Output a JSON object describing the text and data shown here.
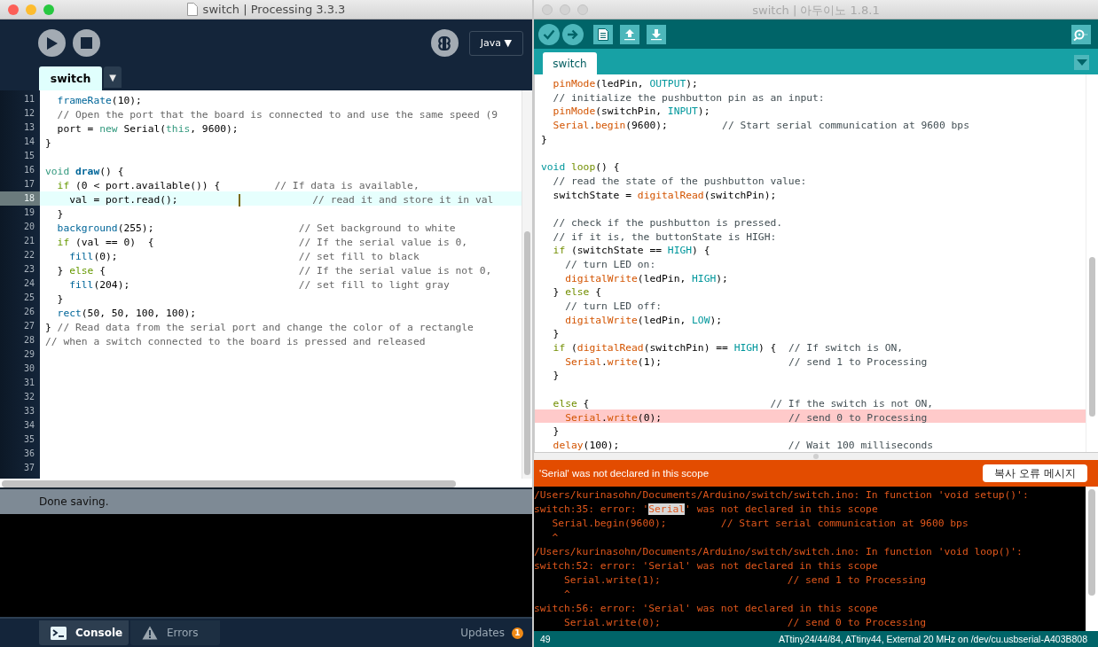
{
  "processing": {
    "title": "switch | Processing 3.3.3",
    "mode": "Java ▼",
    "tab": "switch",
    "tab_menu": "▼",
    "lines": [
      {
        "number": "11",
        "highlighted": false,
        "tokens": [
          {
            "text": "  frameRate",
            "kind": "fn"
          },
          {
            "text": "(10);",
            "kind": "t"
          }
        ]
      },
      {
        "number": "12",
        "highlighted": false,
        "tokens": [
          {
            "text": "  // Open the port that the board is connected to and use the same speed (9",
            "kind": "c"
          }
        ]
      },
      {
        "number": "13",
        "highlighted": false,
        "tokens": [
          {
            "text": "  port = ",
            "kind": "t"
          },
          {
            "text": "new",
            "kind": "kw"
          },
          {
            "text": " Serial(",
            "kind": "t"
          },
          {
            "text": "this",
            "kind": "kw"
          },
          {
            "text": ", 9600);",
            "kind": "t"
          }
        ]
      },
      {
        "number": "14",
        "highlighted": false,
        "tokens": [
          {
            "text": "}",
            "kind": "t"
          }
        ]
      },
      {
        "number": "15",
        "highlighted": false
      },
      {
        "number": "16",
        "highlighted": false,
        "tokens": [
          {
            "text": "void",
            "kind": "kw"
          },
          {
            "text": " draw",
            "kind": "fnb"
          },
          {
            "text": "() {",
            "kind": "t"
          }
        ]
      },
      {
        "number": "17",
        "highlighted": false,
        "tokens": [
          {
            "text": "  if",
            "kind": "ctl"
          },
          {
            "text": " (0 < port.available()) {         ",
            "kind": "t"
          },
          {
            "text": "// If data is available,",
            "kind": "c"
          }
        ]
      },
      {
        "number": "18",
        "highlighted": true,
        "cursor": true,
        "tokens": [
          {
            "text": "    val = port.read();          ",
            "kind": "t"
          },
          {
            "text": "            // read it and store it in val",
            "kind": "c"
          }
        ]
      },
      {
        "number": "19",
        "highlighted": false,
        "tokens": [
          {
            "text": "  }",
            "kind": "t"
          }
        ]
      },
      {
        "number": "20",
        "highlighted": false,
        "tokens": [
          {
            "text": "  background",
            "kind": "fn"
          },
          {
            "text": "(255);                        ",
            "kind": "t"
          },
          {
            "text": "// Set background to white",
            "kind": "c"
          }
        ]
      },
      {
        "number": "21",
        "highlighted": false,
        "tokens": [
          {
            "text": "  if",
            "kind": "ctl"
          },
          {
            "text": " (val == 0)  {                        ",
            "kind": "t"
          },
          {
            "text": "// If the serial value is 0,",
            "kind": "c"
          }
        ]
      },
      {
        "number": "22",
        "highlighted": false,
        "tokens": [
          {
            "text": "    fill",
            "kind": "fn"
          },
          {
            "text": "(0);                              ",
            "kind": "t"
          },
          {
            "text": "// set fill to black",
            "kind": "c"
          }
        ]
      },
      {
        "number": "23",
        "highlighted": false,
        "tokens": [
          {
            "text": "  } ",
            "kind": "t"
          },
          {
            "text": "else",
            "kind": "ctl"
          },
          {
            "text": " {                                ",
            "kind": "t"
          },
          {
            "text": "// If the serial value is not 0,",
            "kind": "c"
          }
        ]
      },
      {
        "number": "24",
        "highlighted": false,
        "tokens": [
          {
            "text": "    fill",
            "kind": "fn"
          },
          {
            "text": "(204);                            ",
            "kind": "t"
          },
          {
            "text": "// set fill to light gray",
            "kind": "c"
          }
        ]
      },
      {
        "number": "25",
        "highlighted": false,
        "tokens": [
          {
            "text": "  }",
            "kind": "t"
          }
        ]
      },
      {
        "number": "26",
        "highlighted": false,
        "tokens": [
          {
            "text": "  rect",
            "kind": "fn"
          },
          {
            "text": "(50, 50, 100, 100);",
            "kind": "t"
          }
        ]
      },
      {
        "number": "27",
        "highlighted": false,
        "tokens": [
          {
            "text": "} ",
            "kind": "t"
          },
          {
            "text": "// Read data from the serial port and change the color of a rectangle",
            "kind": "c"
          }
        ]
      },
      {
        "number": "28",
        "highlighted": false,
        "tokens": [
          {
            "text": "// when a switch connected to the board is pressed and released",
            "kind": "c"
          }
        ]
      },
      {
        "number": "29",
        "highlighted": false
      },
      {
        "number": "30",
        "highlighted": false
      },
      {
        "number": "31",
        "highlighted": false
      },
      {
        "number": "32",
        "highlighted": false
      },
      {
        "number": "33",
        "highlighted": false
      },
      {
        "number": "34",
        "highlighted": false
      },
      {
        "number": "35",
        "highlighted": false
      },
      {
        "number": "36",
        "highlighted": false
      },
      {
        "number": "37",
        "highlighted": false
      }
    ],
    "status": "Done saving.",
    "console_tabs": [
      {
        "label": "Console",
        "selected": true,
        "kind": "console"
      },
      {
        "label": "Errors",
        "selected": false,
        "kind": "errors"
      }
    ],
    "updates": {
      "label": "Updates",
      "count": "1"
    }
  },
  "arduino": {
    "title": "switch | 아두이노 1.8.1",
    "tab": "switch",
    "lines": [
      {
        "highlighted": false,
        "tokens": [
          {
            "text": "  pinMode",
            "kind": "fn"
          },
          {
            "text": "(ledPin, ",
            "kind": "t"
          },
          {
            "text": "OUTPUT",
            "kind": "const"
          },
          {
            "text": ");",
            "kind": "t"
          }
        ]
      },
      {
        "highlighted": false,
        "tokens": [
          {
            "text": "  // initialize the pushbutton pin as an input:",
            "kind": "c"
          }
        ]
      },
      {
        "highlighted": false,
        "tokens": [
          {
            "text": "  pinMode",
            "kind": "fn"
          },
          {
            "text": "(switchPin, ",
            "kind": "t"
          },
          {
            "text": "INPUT",
            "kind": "const"
          },
          {
            "text": ");",
            "kind": "t"
          }
        ]
      },
      {
        "highlighted": false,
        "tokens": [
          {
            "text": "  Serial",
            "kind": "fn"
          },
          {
            "text": ".",
            "kind": "t"
          },
          {
            "text": "begin",
            "kind": "fn"
          },
          {
            "text": "(9600);         ",
            "kind": "t"
          },
          {
            "text": "// Start serial communication at 9600 bps",
            "kind": "c"
          }
        ]
      },
      {
        "highlighted": false,
        "tokens": [
          {
            "text": "}",
            "kind": "t"
          }
        ]
      },
      {
        "highlighted": false
      },
      {
        "highlighted": false,
        "tokens": [
          {
            "text": "void",
            "kind": "type"
          },
          {
            "text": " loop",
            "kind": "kw"
          },
          {
            "text": "() {",
            "kind": "t"
          }
        ]
      },
      {
        "highlighted": false,
        "tokens": [
          {
            "text": "  // read the state of the pushbutton value:",
            "kind": "c"
          }
        ]
      },
      {
        "highlighted": false,
        "tokens": [
          {
            "text": "  switchState = ",
            "kind": "t"
          },
          {
            "text": "digitalRead",
            "kind": "fn"
          },
          {
            "text": "(switchPin);",
            "kind": "t"
          }
        ]
      },
      {
        "highlighted": false
      },
      {
        "highlighted": false,
        "tokens": [
          {
            "text": "  // check if the pushbutton is pressed.",
            "kind": "c"
          }
        ]
      },
      {
        "highlighted": false,
        "tokens": [
          {
            "text": "  // if it is, the buttonState is HIGH:",
            "kind": "c"
          }
        ]
      },
      {
        "highlighted": false,
        "tokens": [
          {
            "text": "  if",
            "kind": "kw"
          },
          {
            "text": " (switchState == ",
            "kind": "t"
          },
          {
            "text": "HIGH",
            "kind": "const"
          },
          {
            "text": ") {",
            "kind": "t"
          }
        ]
      },
      {
        "highlighted": false,
        "tokens": [
          {
            "text": "    // turn LED on:",
            "kind": "c"
          }
        ]
      },
      {
        "highlighted": false,
        "tokens": [
          {
            "text": "    digitalWrite",
            "kind": "fn"
          },
          {
            "text": "(ledPin, ",
            "kind": "t"
          },
          {
            "text": "HIGH",
            "kind": "const"
          },
          {
            "text": ");",
            "kind": "t"
          }
        ]
      },
      {
        "highlighted": false,
        "tokens": [
          {
            "text": "  } ",
            "kind": "t"
          },
          {
            "text": "else",
            "kind": "kw"
          },
          {
            "text": " {",
            "kind": "t"
          }
        ]
      },
      {
        "highlighted": false,
        "tokens": [
          {
            "text": "    // turn LED off:",
            "kind": "c"
          }
        ]
      },
      {
        "highlighted": false,
        "tokens": [
          {
            "text": "    digitalWrite",
            "kind": "fn"
          },
          {
            "text": "(ledPin, ",
            "kind": "t"
          },
          {
            "text": "LOW",
            "kind": "const"
          },
          {
            "text": ");",
            "kind": "t"
          }
        ]
      },
      {
        "highlighted": false,
        "tokens": [
          {
            "text": "  }",
            "kind": "t"
          }
        ]
      },
      {
        "highlighted": false,
        "tokens": [
          {
            "text": "  if",
            "kind": "kw"
          },
          {
            "text": " (",
            "kind": "t"
          },
          {
            "text": "digitalRead",
            "kind": "fn"
          },
          {
            "text": "(switchPin) == ",
            "kind": "t"
          },
          {
            "text": "HIGH",
            "kind": "const"
          },
          {
            "text": ") {  ",
            "kind": "t"
          },
          {
            "text": "// If switch is ON,",
            "kind": "c"
          }
        ]
      },
      {
        "highlighted": false,
        "tokens": [
          {
            "text": "    Serial",
            "kind": "fn"
          },
          {
            "text": ".",
            "kind": "t"
          },
          {
            "text": "write",
            "kind": "fn"
          },
          {
            "text": "(1);                     ",
            "kind": "t"
          },
          {
            "text": "// send 1 to Processing",
            "kind": "c"
          }
        ]
      },
      {
        "highlighted": false,
        "tokens": [
          {
            "text": "  }",
            "kind": "t"
          }
        ]
      },
      {
        "highlighted": false
      },
      {
        "highlighted": false,
        "tokens": [
          {
            "text": "  else",
            "kind": "kw"
          },
          {
            "text": " {                              ",
            "kind": "t"
          },
          {
            "text": "// If the switch is not ON,",
            "kind": "c"
          }
        ]
      },
      {
        "highlighted": true,
        "tokens": [
          {
            "text": "    Serial",
            "kind": "fn"
          },
          {
            "text": ".",
            "kind": "t"
          },
          {
            "text": "write",
            "kind": "fn"
          },
          {
            "text": "(0);                     ",
            "kind": "t"
          },
          {
            "text": "// send 0 to Processing",
            "kind": "c"
          }
        ]
      },
      {
        "highlighted": false,
        "tokens": [
          {
            "text": "  }",
            "kind": "t"
          }
        ]
      },
      {
        "highlighted": false,
        "tokens": [
          {
            "text": "  delay",
            "kind": "fn"
          },
          {
            "text": "(100);                            ",
            "kind": "t"
          },
          {
            "text": "// Wait 100 milliseconds",
            "kind": "c"
          }
        ]
      }
    ],
    "error_message": "'Serial' was not declared in this scope",
    "copy_button": "복사 오류 메시지",
    "console": [
      {
        "tokens": [
          {
            "text": "/Users/kurinasohn/Documents/Arduino/switch/switch.ino: In function 'void setup()':",
            "kind": "t"
          }
        ]
      },
      {
        "tokens": [
          {
            "text": "switch:35: error: '",
            "kind": "t"
          },
          {
            "text": "Serial",
            "kind": "hl"
          },
          {
            "text": "' was not declared in this scope",
            "kind": "t"
          }
        ]
      },
      {
        "tokens": [
          {
            "text": "   Serial.begin(9600);         // Start serial communication at 9600 bps",
            "kind": "t"
          }
        ]
      },
      {
        "tokens": [
          {
            "text": "   ^",
            "kind": "t"
          }
        ]
      },
      {
        "tokens": [
          {
            "text": "/Users/kurinasohn/Documents/Arduino/switch/switch.ino: In function 'void loop()':",
            "kind": "t"
          }
        ]
      },
      {
        "tokens": [
          {
            "text": "switch:52: error: 'Serial' was not declared in this scope",
            "kind": "t"
          }
        ]
      },
      {
        "tokens": [
          {
            "text": "     Serial.write(1);                     // send 1 to Processing",
            "kind": "t"
          }
        ]
      },
      {
        "tokens": [
          {
            "text": "     ^",
            "kind": "t"
          }
        ]
      },
      {
        "tokens": [
          {
            "text": "switch:56: error: 'Serial' was not declared in this scope",
            "kind": "t"
          }
        ]
      },
      {
        "tokens": [
          {
            "text": "     Serial.write(0);                     // send 0 to Processing",
            "kind": "t"
          }
        ]
      }
    ],
    "status_line": "49",
    "status_board": "ATtiny24/44/84, ATtiny44, External 20 MHz on /dev/cu.usbserial-A403B808"
  }
}
